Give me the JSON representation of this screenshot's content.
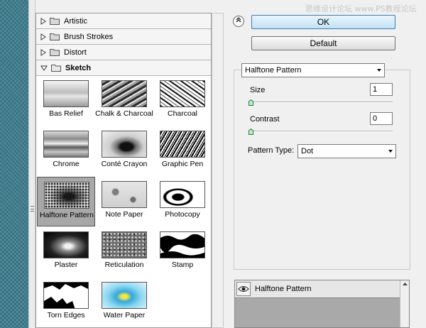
{
  "watermark": "思缘设计论坛 www.PS教程论坛",
  "categories": [
    {
      "label": "Artistic",
      "expanded": false
    },
    {
      "label": "Brush Strokes",
      "expanded": false
    },
    {
      "label": "Distort",
      "expanded": false
    },
    {
      "label": "Sketch",
      "expanded": true
    }
  ],
  "filters": [
    {
      "label": "Bas Relief"
    },
    {
      "label": "Chalk & Charcoal"
    },
    {
      "label": "Charcoal"
    },
    {
      "label": "Chrome"
    },
    {
      "label": "Conté Crayon"
    },
    {
      "label": "Graphic Pen"
    },
    {
      "label": "Halftone Pattern",
      "selected": true
    },
    {
      "label": "Note Paper"
    },
    {
      "label": "Photocopy"
    },
    {
      "label": "Plaster"
    },
    {
      "label": "Reticulation"
    },
    {
      "label": "Stamp"
    },
    {
      "label": "Torn Edges"
    },
    {
      "label": "Water Paper"
    }
  ],
  "buttons": {
    "ok": "OK",
    "default": "Default"
  },
  "settings": {
    "filter_select": "Halftone Pattern",
    "size_label": "Size",
    "size_value": "1",
    "contrast_label": "Contrast",
    "contrast_value": "0",
    "pattern_type_label": "Pattern Type:",
    "pattern_type_value": "Dot"
  },
  "layers": {
    "item": "Halftone Pattern"
  },
  "icons": {
    "collapse": "double-chevron-up-icon",
    "visibility": "eye-icon",
    "expand": "triangle-right-icon",
    "folder": "folder-icon"
  }
}
